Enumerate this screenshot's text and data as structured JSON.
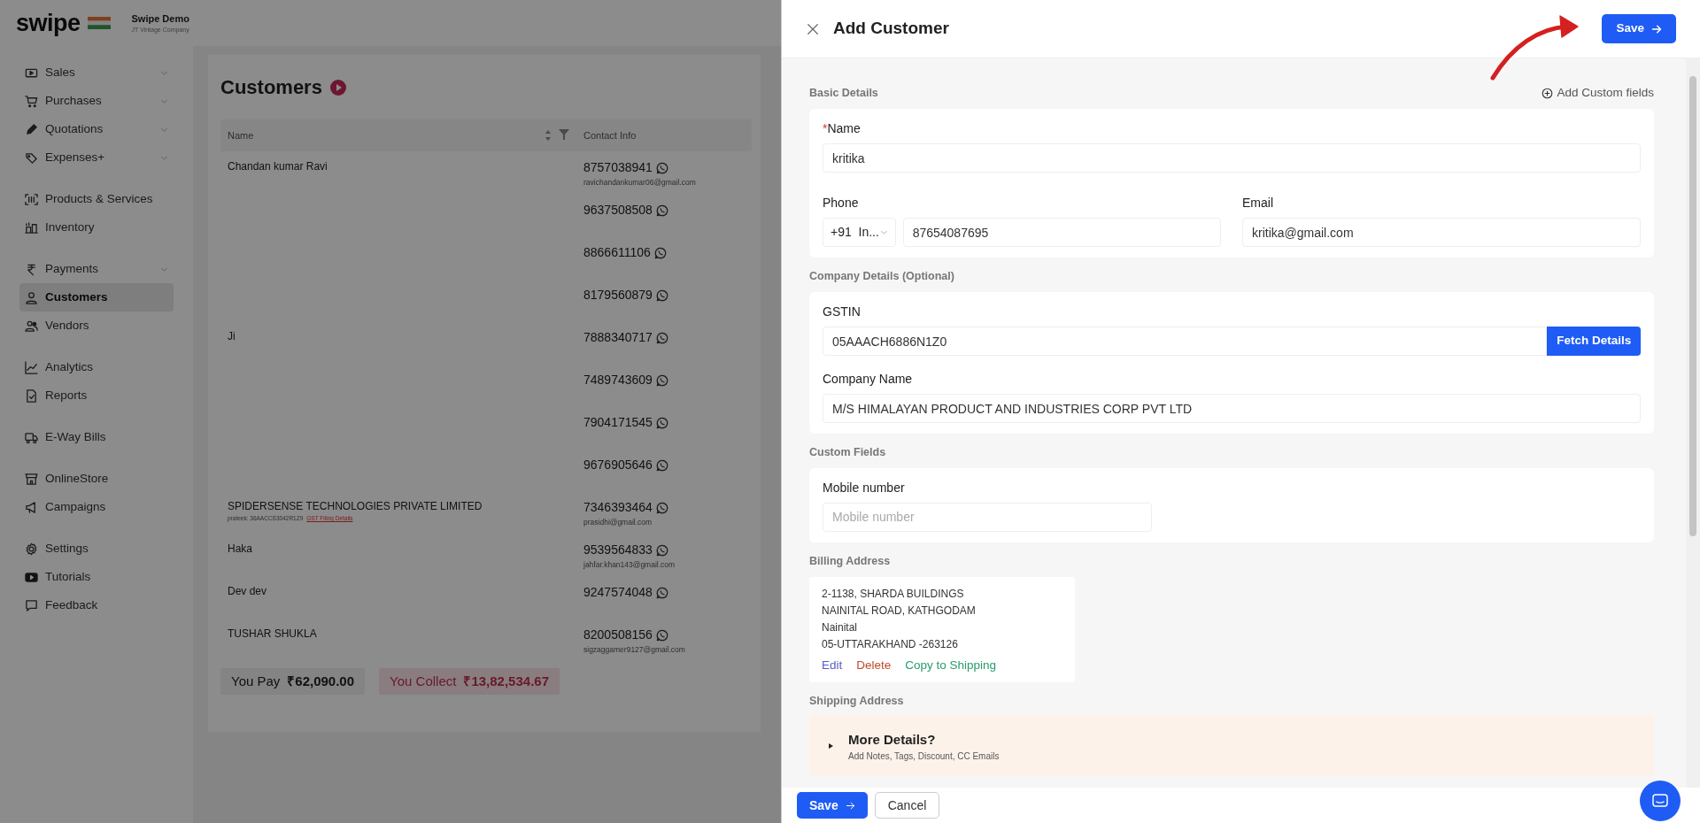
{
  "app_header": {
    "logo": "swipe",
    "company_name": "Swipe Demo",
    "company_subtitle": "JT Vintage Company"
  },
  "sidebar": {
    "groups": [
      {
        "items": [
          {
            "label": "Sales",
            "expandable": true,
            "selected": false
          },
          {
            "label": "Purchases",
            "expandable": true,
            "selected": false
          },
          {
            "label": "Quotations",
            "expandable": true,
            "selected": false
          },
          {
            "label": "Expenses+",
            "expandable": true,
            "selected": false
          }
        ]
      },
      {
        "items": [
          {
            "label": "Products & Services",
            "expandable": false,
            "selected": false
          },
          {
            "label": "Inventory",
            "expandable": false,
            "selected": false
          }
        ]
      },
      {
        "items": [
          {
            "label": "Payments",
            "expandable": true,
            "selected": false
          },
          {
            "label": "Customers",
            "expandable": false,
            "selected": true
          },
          {
            "label": "Vendors",
            "expandable": false,
            "selected": false
          }
        ]
      },
      {
        "items": [
          {
            "label": "Analytics",
            "expandable": false,
            "selected": false
          },
          {
            "label": "Reports",
            "expandable": false,
            "selected": false
          }
        ]
      },
      {
        "items": [
          {
            "label": "E-Way Bills",
            "expandable": false,
            "selected": false
          }
        ]
      },
      {
        "items": [
          {
            "label": "OnlineStore",
            "expandable": false,
            "selected": false
          },
          {
            "label": "Campaigns",
            "expandable": false,
            "selected": false
          }
        ]
      },
      {
        "items": [
          {
            "label": "Settings",
            "expandable": false,
            "selected": false
          },
          {
            "label": "Tutorials",
            "expandable": false,
            "selected": false
          },
          {
            "label": "Feedback",
            "expandable": false,
            "selected": false
          }
        ]
      }
    ]
  },
  "page": {
    "title": "Customers",
    "columns": [
      "Name",
      "Contact Info"
    ],
    "rows": [
      {
        "name": "Chandan kumar Ravi",
        "phone": "8757038941",
        "email": "ravichandankumar06@gmail.com"
      },
      {
        "phone": "9637508508"
      },
      {
        "phone": "8866611106"
      },
      {
        "phone": "8179560879"
      },
      {
        "name": "Ji",
        "phone": "7888340717"
      },
      {
        "phone": "7489743609"
      },
      {
        "phone": "7904171545"
      },
      {
        "phone": "9676905646"
      },
      {
        "name": "SPIDERSENSE TECHNOLOGIES PRIVATE LIMITED",
        "detail": "prateek: 36AACCS3042R1Z9",
        "detail_link": "GST Filing Details",
        "phone": "7346393464",
        "email": "prasidhi@gmail.com"
      },
      {
        "name": "Haka",
        "phone": "9539564833",
        "email": "jahfar.khan143@gmail.com"
      },
      {
        "name": "Dev dev",
        "phone": "9247574048"
      },
      {
        "name": "TUSHAR SHUKLA",
        "phone": "8200508156",
        "email": "sigzaggamer9127@gmail.com"
      }
    ],
    "totals": [
      {
        "label": "You Pay",
        "amount": "₹62,090.00",
        "kind": "pay"
      },
      {
        "label": "You Collect",
        "amount": "₹13,82,534.67",
        "kind": "collect"
      }
    ]
  },
  "drawer": {
    "title": "Add Customer",
    "save_label": "Save",
    "basic_details": {
      "heading": "Basic Details",
      "action": "Add Custom fields",
      "name": {
        "label": "Name",
        "required_mark": "*",
        "value": "kritika"
      },
      "phone": {
        "label": "Phone",
        "country_code": "+91  In...",
        "value": "87654087695"
      },
      "email": {
        "label": "Email",
        "value": "kritika@gmail.com"
      }
    },
    "company_details": {
      "heading": "Company Details (Optional)",
      "gstin": {
        "label": "GSTIN",
        "value": "05AAACH6886N1Z0",
        "button": "Fetch Details"
      },
      "company_name": {
        "label": "Company Name",
        "value": "M/S HIMALAYAN PRODUCT AND INDUSTRIES CORP PVT LTD"
      }
    },
    "custom_fields": {
      "heading": "Custom Fields",
      "fields": [
        {
          "label": "Mobile number",
          "placeholder": "Mobile number"
        }
      ]
    },
    "billing_address": {
      "heading": "Billing Address",
      "lines": [
        "2-1138, SHARDA BUILDINGS",
        "NAINITAL ROAD, KATHGODAM",
        "Nainital",
        "05-UTTARAKHAND -263126"
      ],
      "actions": [
        {
          "label": "Edit",
          "kind": "edit"
        },
        {
          "label": "Delete",
          "kind": "delete"
        },
        {
          "label": "Copy to Shipping",
          "kind": "copy"
        }
      ]
    },
    "shipping_address": {
      "heading": "Shipping Address"
    },
    "more_details": {
      "title": "More Details?",
      "subtitle": "Add Notes, Tags, Discount, CC Emails",
      "expanded": false
    },
    "footer": {
      "buttons": [
        {
          "label": "Save",
          "kind": "primary"
        },
        {
          "label": "Cancel",
          "kind": "secondary"
        }
      ]
    }
  }
}
